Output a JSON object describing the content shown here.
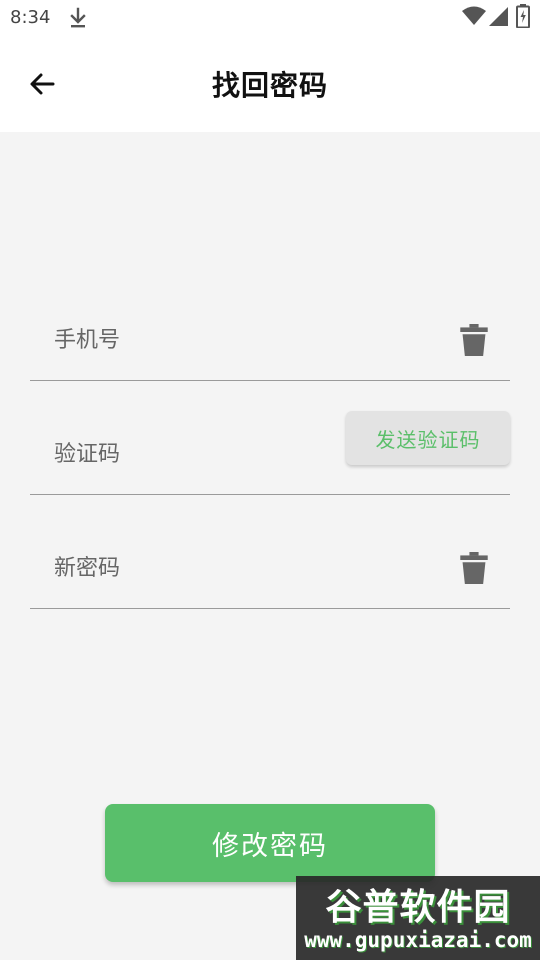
{
  "status_bar": {
    "time": "8:34",
    "icons": [
      "download-icon",
      "wifi-icon",
      "signal-icon",
      "battery-icon"
    ]
  },
  "header": {
    "title": "找回密码",
    "back_icon": "arrow-left-icon"
  },
  "form": {
    "phone": {
      "placeholder": "手机号",
      "value": "",
      "action_icon": "trash-icon"
    },
    "code": {
      "placeholder": "验证码",
      "value": "",
      "send_label": "发送验证码"
    },
    "new_password": {
      "placeholder": "新密码",
      "value": "",
      "action_icon": "trash-icon"
    }
  },
  "submit_label": "修改密码",
  "watermark": {
    "title": "谷普软件园",
    "url": "www.gupuxiazai.com"
  },
  "colors": {
    "accent": "#59bf6b",
    "background": "#f4f4f4",
    "send_button_bg": "#e3e3e3"
  }
}
